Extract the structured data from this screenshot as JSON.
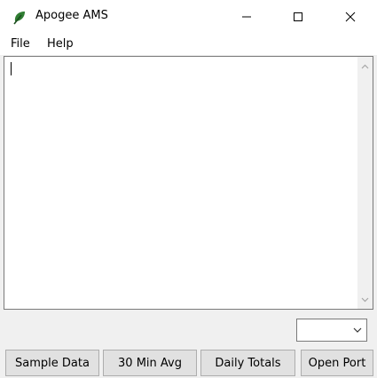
{
  "window": {
    "title": "Apogee AMS",
    "icon": "leaf-icon",
    "controls": [
      "minimize-icon",
      "maximize-icon",
      "close-icon"
    ]
  },
  "menu": {
    "items": [
      {
        "label": "File"
      },
      {
        "label": "Help"
      }
    ]
  },
  "output": {
    "text": "",
    "scroll_icons": [
      "scroll-up-arrow-icon",
      "scroll-down-arrow-icon"
    ]
  },
  "port_select": {
    "value": "",
    "icon": "chevron-down-icon"
  },
  "buttons": {
    "sample_data": "Sample Data",
    "min_avg": "30 Min Avg",
    "daily_totals": "Daily Totals",
    "open_port": "Open Port"
  },
  "colors": {
    "leaf": "#2f7d32",
    "button_face": "#e1e1e1",
    "window_bg": "#f0f0f0"
  }
}
